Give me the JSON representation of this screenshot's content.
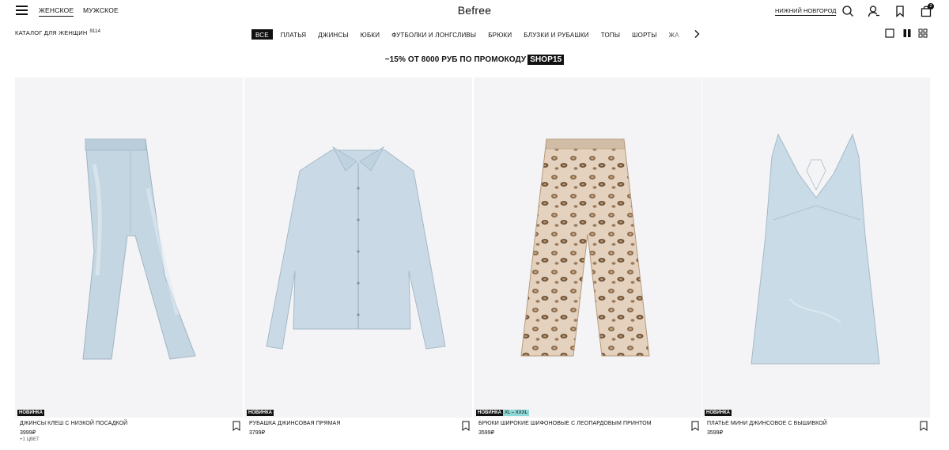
{
  "header": {
    "menu_icon": "hamburger-icon",
    "genders": [
      {
        "label": "ЖЕНСКОЕ",
        "active": true
      },
      {
        "label": "МУЖСКОЕ",
        "active": false
      }
    ],
    "logo": "Befree",
    "city": "НИЖНИЙ НОВГОРОД",
    "icons": [
      "search-icon",
      "user-icon",
      "bookmark-icon",
      "cart-icon"
    ],
    "cart_count": "2"
  },
  "catalog": {
    "title": "КАТАЛОГ ДЛЯ ЖЕНЩИН",
    "count": "9114",
    "categories": [
      {
        "label": "ВСЕ",
        "active": true
      },
      {
        "label": "ПЛАТЬЯ"
      },
      {
        "label": "ДЖИНСЫ"
      },
      {
        "label": "ЮБКИ"
      },
      {
        "label": "ФУТБОЛКИ И ЛОНГСЛИВЫ"
      },
      {
        "label": "БРЮКИ"
      },
      {
        "label": "БЛУЗКИ И РУБАШКИ"
      },
      {
        "label": "ТОПЫ"
      },
      {
        "label": "ШОРТЫ"
      },
      {
        "label": "ЖА"
      }
    ],
    "view_modes": [
      "single-view-icon",
      "two-column-view-icon",
      "four-grid-view-icon"
    ]
  },
  "promo": {
    "text": "−15% ОТ 8000 РУБ ПО ПРОМОКОДУ",
    "code": "SHOP15"
  },
  "products": [
    {
      "badge": "НОВИНКА",
      "extra_badge": "",
      "name": "ДЖИНСЫ КЛЕШ С НИЗКОЙ ПОСАДКОЙ",
      "price": "3999₽",
      "colors": "+1 ЦВЕТ",
      "image": "flared-jeans"
    },
    {
      "badge": "НОВИНКА",
      "extra_badge": "",
      "name": "РУБАШКА ДЖИНСОВАЯ ПРЯМАЯ",
      "price": "3799₽",
      "colors": "",
      "image": "denim-shirt"
    },
    {
      "badge": "НОВИНКА",
      "extra_badge": "XL – XXXL",
      "name": "БРЮКИ ШИРОКИЕ ШИФОНОВЫЕ С ЛЕОПАРДОВЫМ ПРИНТОМ",
      "price": "3599₽",
      "colors": "",
      "image": "leopard-trousers"
    },
    {
      "badge": "НОВИНКА",
      "extra_badge": "",
      "name": "ПЛАТЬЕ МИНИ ДЖИНСОВОЕ С ВЫШИВКОЙ",
      "price": "3599₽",
      "colors": "",
      "image": "denim-mini-dress"
    }
  ],
  "colors": {
    "text": "#111111",
    "photo_bg": "#f4f4f6",
    "denim": "#c9dae6",
    "size_badge": "#8fd8d8"
  }
}
